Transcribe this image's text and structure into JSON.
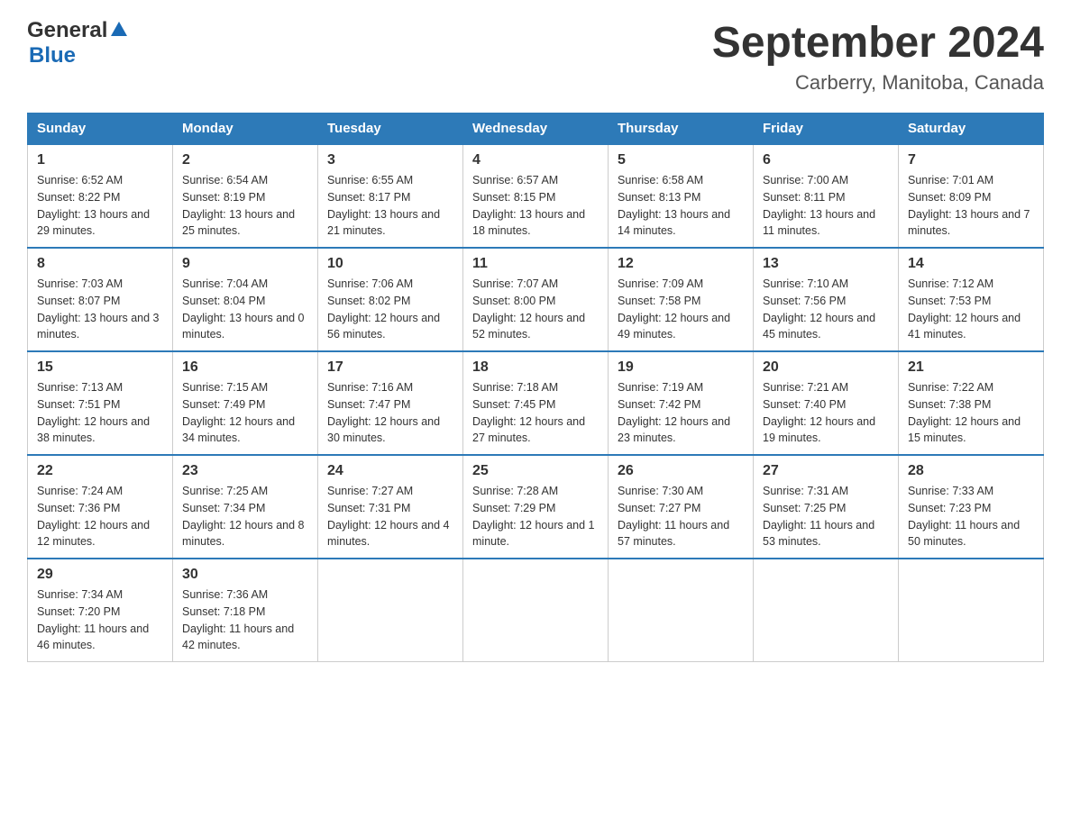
{
  "header": {
    "logo_general": "General",
    "logo_blue": "Blue",
    "title": "September 2024",
    "subtitle": "Carberry, Manitoba, Canada"
  },
  "days_header": [
    "Sunday",
    "Monday",
    "Tuesday",
    "Wednesday",
    "Thursday",
    "Friday",
    "Saturday"
  ],
  "weeks": [
    [
      {
        "day": "1",
        "sunrise": "Sunrise: 6:52 AM",
        "sunset": "Sunset: 8:22 PM",
        "daylight": "Daylight: 13 hours and 29 minutes."
      },
      {
        "day": "2",
        "sunrise": "Sunrise: 6:54 AM",
        "sunset": "Sunset: 8:19 PM",
        "daylight": "Daylight: 13 hours and 25 minutes."
      },
      {
        "day": "3",
        "sunrise": "Sunrise: 6:55 AM",
        "sunset": "Sunset: 8:17 PM",
        "daylight": "Daylight: 13 hours and 21 minutes."
      },
      {
        "day": "4",
        "sunrise": "Sunrise: 6:57 AM",
        "sunset": "Sunset: 8:15 PM",
        "daylight": "Daylight: 13 hours and 18 minutes."
      },
      {
        "day": "5",
        "sunrise": "Sunrise: 6:58 AM",
        "sunset": "Sunset: 8:13 PM",
        "daylight": "Daylight: 13 hours and 14 minutes."
      },
      {
        "day": "6",
        "sunrise": "Sunrise: 7:00 AM",
        "sunset": "Sunset: 8:11 PM",
        "daylight": "Daylight: 13 hours and 11 minutes."
      },
      {
        "day": "7",
        "sunrise": "Sunrise: 7:01 AM",
        "sunset": "Sunset: 8:09 PM",
        "daylight": "Daylight: 13 hours and 7 minutes."
      }
    ],
    [
      {
        "day": "8",
        "sunrise": "Sunrise: 7:03 AM",
        "sunset": "Sunset: 8:07 PM",
        "daylight": "Daylight: 13 hours and 3 minutes."
      },
      {
        "day": "9",
        "sunrise": "Sunrise: 7:04 AM",
        "sunset": "Sunset: 8:04 PM",
        "daylight": "Daylight: 13 hours and 0 minutes."
      },
      {
        "day": "10",
        "sunrise": "Sunrise: 7:06 AM",
        "sunset": "Sunset: 8:02 PM",
        "daylight": "Daylight: 12 hours and 56 minutes."
      },
      {
        "day": "11",
        "sunrise": "Sunrise: 7:07 AM",
        "sunset": "Sunset: 8:00 PM",
        "daylight": "Daylight: 12 hours and 52 minutes."
      },
      {
        "day": "12",
        "sunrise": "Sunrise: 7:09 AM",
        "sunset": "Sunset: 7:58 PM",
        "daylight": "Daylight: 12 hours and 49 minutes."
      },
      {
        "day": "13",
        "sunrise": "Sunrise: 7:10 AM",
        "sunset": "Sunset: 7:56 PM",
        "daylight": "Daylight: 12 hours and 45 minutes."
      },
      {
        "day": "14",
        "sunrise": "Sunrise: 7:12 AM",
        "sunset": "Sunset: 7:53 PM",
        "daylight": "Daylight: 12 hours and 41 minutes."
      }
    ],
    [
      {
        "day": "15",
        "sunrise": "Sunrise: 7:13 AM",
        "sunset": "Sunset: 7:51 PM",
        "daylight": "Daylight: 12 hours and 38 minutes."
      },
      {
        "day": "16",
        "sunrise": "Sunrise: 7:15 AM",
        "sunset": "Sunset: 7:49 PM",
        "daylight": "Daylight: 12 hours and 34 minutes."
      },
      {
        "day": "17",
        "sunrise": "Sunrise: 7:16 AM",
        "sunset": "Sunset: 7:47 PM",
        "daylight": "Daylight: 12 hours and 30 minutes."
      },
      {
        "day": "18",
        "sunrise": "Sunrise: 7:18 AM",
        "sunset": "Sunset: 7:45 PM",
        "daylight": "Daylight: 12 hours and 27 minutes."
      },
      {
        "day": "19",
        "sunrise": "Sunrise: 7:19 AM",
        "sunset": "Sunset: 7:42 PM",
        "daylight": "Daylight: 12 hours and 23 minutes."
      },
      {
        "day": "20",
        "sunrise": "Sunrise: 7:21 AM",
        "sunset": "Sunset: 7:40 PM",
        "daylight": "Daylight: 12 hours and 19 minutes."
      },
      {
        "day": "21",
        "sunrise": "Sunrise: 7:22 AM",
        "sunset": "Sunset: 7:38 PM",
        "daylight": "Daylight: 12 hours and 15 minutes."
      }
    ],
    [
      {
        "day": "22",
        "sunrise": "Sunrise: 7:24 AM",
        "sunset": "Sunset: 7:36 PM",
        "daylight": "Daylight: 12 hours and 12 minutes."
      },
      {
        "day": "23",
        "sunrise": "Sunrise: 7:25 AM",
        "sunset": "Sunset: 7:34 PM",
        "daylight": "Daylight: 12 hours and 8 minutes."
      },
      {
        "day": "24",
        "sunrise": "Sunrise: 7:27 AM",
        "sunset": "Sunset: 7:31 PM",
        "daylight": "Daylight: 12 hours and 4 minutes."
      },
      {
        "day": "25",
        "sunrise": "Sunrise: 7:28 AM",
        "sunset": "Sunset: 7:29 PM",
        "daylight": "Daylight: 12 hours and 1 minute."
      },
      {
        "day": "26",
        "sunrise": "Sunrise: 7:30 AM",
        "sunset": "Sunset: 7:27 PM",
        "daylight": "Daylight: 11 hours and 57 minutes."
      },
      {
        "day": "27",
        "sunrise": "Sunrise: 7:31 AM",
        "sunset": "Sunset: 7:25 PM",
        "daylight": "Daylight: 11 hours and 53 minutes."
      },
      {
        "day": "28",
        "sunrise": "Sunrise: 7:33 AM",
        "sunset": "Sunset: 7:23 PM",
        "daylight": "Daylight: 11 hours and 50 minutes."
      }
    ],
    [
      {
        "day": "29",
        "sunrise": "Sunrise: 7:34 AM",
        "sunset": "Sunset: 7:20 PM",
        "daylight": "Daylight: 11 hours and 46 minutes."
      },
      {
        "day": "30",
        "sunrise": "Sunrise: 7:36 AM",
        "sunset": "Sunset: 7:18 PM",
        "daylight": "Daylight: 11 hours and 42 minutes."
      },
      null,
      null,
      null,
      null,
      null
    ]
  ]
}
